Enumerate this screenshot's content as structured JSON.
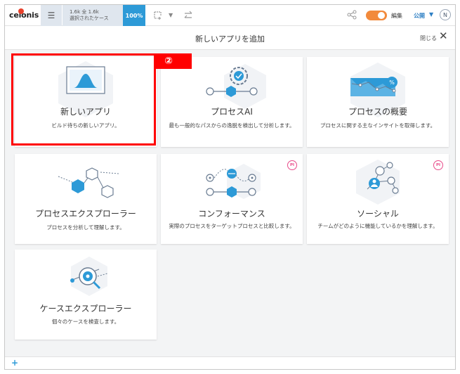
{
  "topbar": {
    "logo": "celonis",
    "case_count": "1.6k 全 1.6k",
    "case_label": "選択されたケース",
    "percent": "100%",
    "edit_label": "編集",
    "public_label": "公開",
    "avatar_initial": "N"
  },
  "header": {
    "title": "新しいアプリを追加",
    "close_label": "閉じる",
    "close_glyph": "✕"
  },
  "cards": [
    {
      "title": "新しいアプリ",
      "desc": "ビルド待ちの新しいアプリ。",
      "icon": "new-app-chart-icon"
    },
    {
      "title": "プロセスAI",
      "desc": "最も一般的なパスからの逸脱を検出して分析します。",
      "icon": "process-ai-gear-icon"
    },
    {
      "title": "プロセスの概要",
      "desc": "プロセスに関する主なインサイトを取得します。",
      "icon": "process-overview-chart-icon"
    },
    {
      "title": "プロセスエクスプローラー",
      "desc": "プロセスを分析して理解します。",
      "icon": "process-explorer-hex-icon"
    },
    {
      "title": "コンフォーマンス",
      "desc": "実際のプロセスをターゲットプロセスと比較します。",
      "icon": "conformance-icon",
      "badge": "PI"
    },
    {
      "title": "ソーシャル",
      "desc": "チームがどのように機能しているかを理解します。",
      "icon": "social-network-icon",
      "badge": "PI"
    },
    {
      "title": "ケースエクスプローラー",
      "desc": "個々のケースを検査します。",
      "icon": "case-explorer-magnifier-icon"
    }
  ],
  "annotation": {
    "step_label": "②",
    "color": "#ff0000"
  },
  "colors": {
    "accent_blue": "#2d9ad7",
    "toggle_orange": "#f28a3c",
    "pi_pink": "#e84b8a"
  },
  "footer": {
    "add_glyph": "+"
  }
}
